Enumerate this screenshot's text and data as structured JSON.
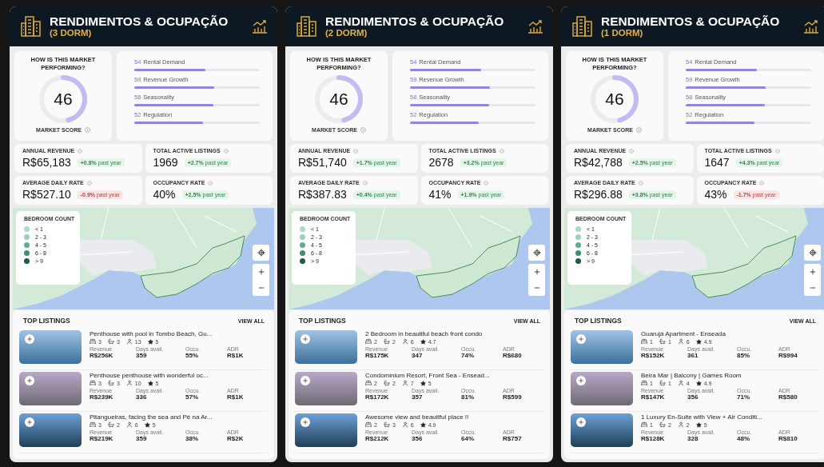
{
  "panels": [
    {
      "title": "RENDIMENTOS & OCUPAÇÃO",
      "subtitle": "(3 DORM)",
      "market": {
        "question": "HOW IS THIS MARKET PERFORMING?",
        "score": "46",
        "level": 0.46,
        "score_label": "MARKET SCORE",
        "factors": [
          {
            "score": "54",
            "label": "Rental Demand",
            "level": 0.57
          },
          {
            "score": "59",
            "label": "Revenue Growth",
            "level": 0.64
          },
          {
            "score": "58",
            "label": "Seasonality",
            "level": 0.63
          },
          {
            "score": "52",
            "label": "Regulation",
            "level": 0.55
          }
        ]
      },
      "metrics": [
        {
          "label": "ANNUAL REVENUE",
          "value": "R$65,183",
          "change": "**+0.8%** past year",
          "kind": "up"
        },
        {
          "label": "TOTAL ACTIVE LISTINGS",
          "value": "1969",
          "change": "**+2.7%** past year",
          "kind": "up"
        },
        {
          "label": "AVERAGE DAILY RATE",
          "value": "R$527.10",
          "change": "**-0.9%** past year",
          "kind": "down"
        },
        {
          "label": "OCCUPANCY RATE",
          "value": "40%",
          "change": "**+2.5%** past year",
          "kind": "up"
        }
      ],
      "map": {
        "legend_title": "BEDROOM COUNT",
        "legend": [
          {
            "label": "< 1",
            "color": "#a9dcc5"
          },
          {
            "label": "2 - 3",
            "color": "#98d2b7"
          },
          {
            "label": "4 - 5",
            "color": "#5fae8d"
          },
          {
            "label": "6 - 8",
            "color": "#3f9070"
          },
          {
            "label": "> 9",
            "color": "#1e5c45"
          }
        ]
      },
      "listings": {
        "title": "TOP LISTINGS",
        "action": "VIEW ALL",
        "items": [
          {
            "title": "Penthouse with pool in Tombo Beach, Gu...",
            "beds": "3",
            "baths": "3",
            "guests": "13",
            "rating": "5",
            "stats": [
              {
                "label": "Revenue",
                "value": "R$256K"
              },
              {
                "label": "Days avail.",
                "value": "359"
              },
              {
                "label": "Occu.",
                "value": "55%"
              },
              {
                "label": "ADR",
                "value": "R$1K"
              }
            ]
          },
          {
            "title": "Penthouse penthouse with wonderful oc...",
            "beds": "3",
            "baths": "3",
            "guests": "10",
            "rating": "5",
            "stats": [
              {
                "label": "Revenue",
                "value": "R$239K"
              },
              {
                "label": "Days avail.",
                "value": "336"
              },
              {
                "label": "Occu.",
                "value": "57%"
              },
              {
                "label": "ADR",
                "value": "R$1K"
              }
            ]
          },
          {
            "title": "Pitangueiras, facing the sea and Pé na Ar...",
            "beds": "3",
            "baths": "2",
            "guests": "6",
            "rating": "5",
            "stats": [
              {
                "label": "Revenue",
                "value": "R$219K"
              },
              {
                "label": "Days avail.",
                "value": "359"
              },
              {
                "label": "Occu.",
                "value": "38%"
              },
              {
                "label": "ADR",
                "value": "R$2K"
              }
            ]
          }
        ]
      }
    },
    {
      "title": "RENDIMENTOS & OCUPAÇÃO",
      "subtitle": "(2 DORM)",
      "market": {
        "question": "HOW IS THIS MARKET PERFORMING?",
        "score": "46",
        "level": 0.46,
        "score_label": "MARKET SCORE",
        "factors": [
          {
            "score": "54",
            "label": "Rental Demand",
            "level": 0.57
          },
          {
            "score": "59",
            "label": "Revenue Growth",
            "level": 0.64
          },
          {
            "score": "58",
            "label": "Seasonality",
            "level": 0.63
          },
          {
            "score": "52",
            "label": "Regulation",
            "level": 0.55
          }
        ]
      },
      "metrics": [
        {
          "label": "ANNUAL REVENUE",
          "value": "R$51,740",
          "change": "**+1.7%** past year",
          "kind": "up"
        },
        {
          "label": "TOTAL ACTIVE LISTINGS",
          "value": "2678",
          "change": "**+3.2%** past year",
          "kind": "up"
        },
        {
          "label": "AVERAGE DAILY RATE",
          "value": "R$387.83",
          "change": "**+0.4%** past year",
          "kind": "up"
        },
        {
          "label": "OCCUPANCY RATE",
          "value": "41%",
          "change": "**+1.9%** past year",
          "kind": "up"
        }
      ],
      "map": {
        "legend_title": "BEDROOM COUNT",
        "legend": [
          {
            "label": "< 1",
            "color": "#a9dcc5"
          },
          {
            "label": "2 - 3",
            "color": "#98d2b7"
          },
          {
            "label": "4 - 5",
            "color": "#5fae8d"
          },
          {
            "label": "6 - 8",
            "color": "#3f9070"
          },
          {
            "label": "> 9",
            "color": "#1e5c45"
          }
        ]
      },
      "listings": {
        "title": "TOP LISTINGS",
        "action": "VIEW ALL",
        "items": [
          {
            "title": "2 Bedroom in beautiful beach front condo",
            "beds": "2",
            "baths": "2",
            "guests": "6",
            "rating": "4.7",
            "stats": [
              {
                "label": "Revenue",
                "value": "R$175K"
              },
              {
                "label": "Days avail.",
                "value": "347"
              },
              {
                "label": "Occu.",
                "value": "74%"
              },
              {
                "label": "ADR",
                "value": "R$680"
              }
            ]
          },
          {
            "title": "Condominium Resort, Front Sea - Ensead...",
            "beds": "2",
            "baths": "2",
            "guests": "7",
            "rating": "5",
            "stats": [
              {
                "label": "Revenue",
                "value": "R$172K"
              },
              {
                "label": "Days avail.",
                "value": "357"
              },
              {
                "label": "Occu.",
                "value": "81%"
              },
              {
                "label": "ADR",
                "value": "R$599"
              }
            ]
          },
          {
            "title": "Awesome view and beautiful place !!",
            "beds": "2",
            "baths": "3",
            "guests": "6",
            "rating": "4.9",
            "stats": [
              {
                "label": "Revenue",
                "value": "R$212K"
              },
              {
                "label": "Days avail.",
                "value": "356"
              },
              {
                "label": "Occu.",
                "value": "64%"
              },
              {
                "label": "ADR",
                "value": "R$757"
              }
            ]
          }
        ]
      }
    },
    {
      "title": "RENDIMENTOS & OCUPAÇÃO",
      "subtitle": "(1 DORM)",
      "market": {
        "question": "HOW IS THIS MARKET PERFORMING?",
        "score": "46",
        "level": 0.46,
        "score_label": "MARKET SCORE",
        "factors": [
          {
            "score": "54",
            "label": "Rental Demand",
            "level": 0.57
          },
          {
            "score": "59",
            "label": "Revenue Growth",
            "level": 0.64
          },
          {
            "score": "58",
            "label": "Seasonality",
            "level": 0.63
          },
          {
            "score": "52",
            "label": "Regulation",
            "level": 0.55
          }
        ]
      },
      "metrics": [
        {
          "label": "ANNUAL REVENUE",
          "value": "R$42,788",
          "change": "**+2.5%** past year",
          "kind": "up"
        },
        {
          "label": "TOTAL ACTIVE LISTINGS",
          "value": "1647",
          "change": "**+4.3%** past year",
          "kind": "up"
        },
        {
          "label": "AVERAGE DAILY RATE",
          "value": "R$296.88",
          "change": "**+3.8%** past year",
          "kind": "up"
        },
        {
          "label": "OCCUPANCY RATE",
          "value": "43%",
          "change": "**-1.7%** past year",
          "kind": "down"
        }
      ],
      "map": {
        "legend_title": "BEDROOM COUNT",
        "legend": [
          {
            "label": "< 1",
            "color": "#a9dcc5"
          },
          {
            "label": "2 - 3",
            "color": "#98d2b7"
          },
          {
            "label": "4 - 5",
            "color": "#5fae8d"
          },
          {
            "label": "6 - 8",
            "color": "#3f9070"
          },
          {
            "label": "> 9",
            "color": "#1e5c45"
          }
        ]
      },
      "listings": {
        "title": "TOP LISTINGS",
        "action": "VIEW ALL",
        "items": [
          {
            "title": "Guarujá Apartment - Enseada",
            "beds": "1",
            "baths": "1",
            "guests": "6",
            "rating": "4.9",
            "stats": [
              {
                "label": "Revenue",
                "value": "R$152K"
              },
              {
                "label": "Days avail.",
                "value": "361"
              },
              {
                "label": "Occu.",
                "value": "85%"
              },
              {
                "label": "ADR",
                "value": "R$994"
              }
            ]
          },
          {
            "title": "Beira Mar | Balcony | Games Room",
            "beds": "1",
            "baths": "1",
            "guests": "4",
            "rating": "4.9",
            "stats": [
              {
                "label": "Revenue",
                "value": "R$147K"
              },
              {
                "label": "Days avail.",
                "value": "356"
              },
              {
                "label": "Occu.",
                "value": "71%"
              },
              {
                "label": "ADR",
                "value": "R$580"
              }
            ]
          },
          {
            "title": "1 Luxury En-Suite with View + Air Conditi...",
            "beds": "1",
            "baths": "2",
            "guests": "2",
            "rating": "5",
            "stats": [
              {
                "label": "Revenue",
                "value": "R$128K"
              },
              {
                "label": "Days avail.",
                "value": "328"
              },
              {
                "label": "Occu.",
                "value": "48%"
              },
              {
                "label": "ADR",
                "value": "R$810"
              }
            ]
          }
        ]
      }
    }
  ]
}
